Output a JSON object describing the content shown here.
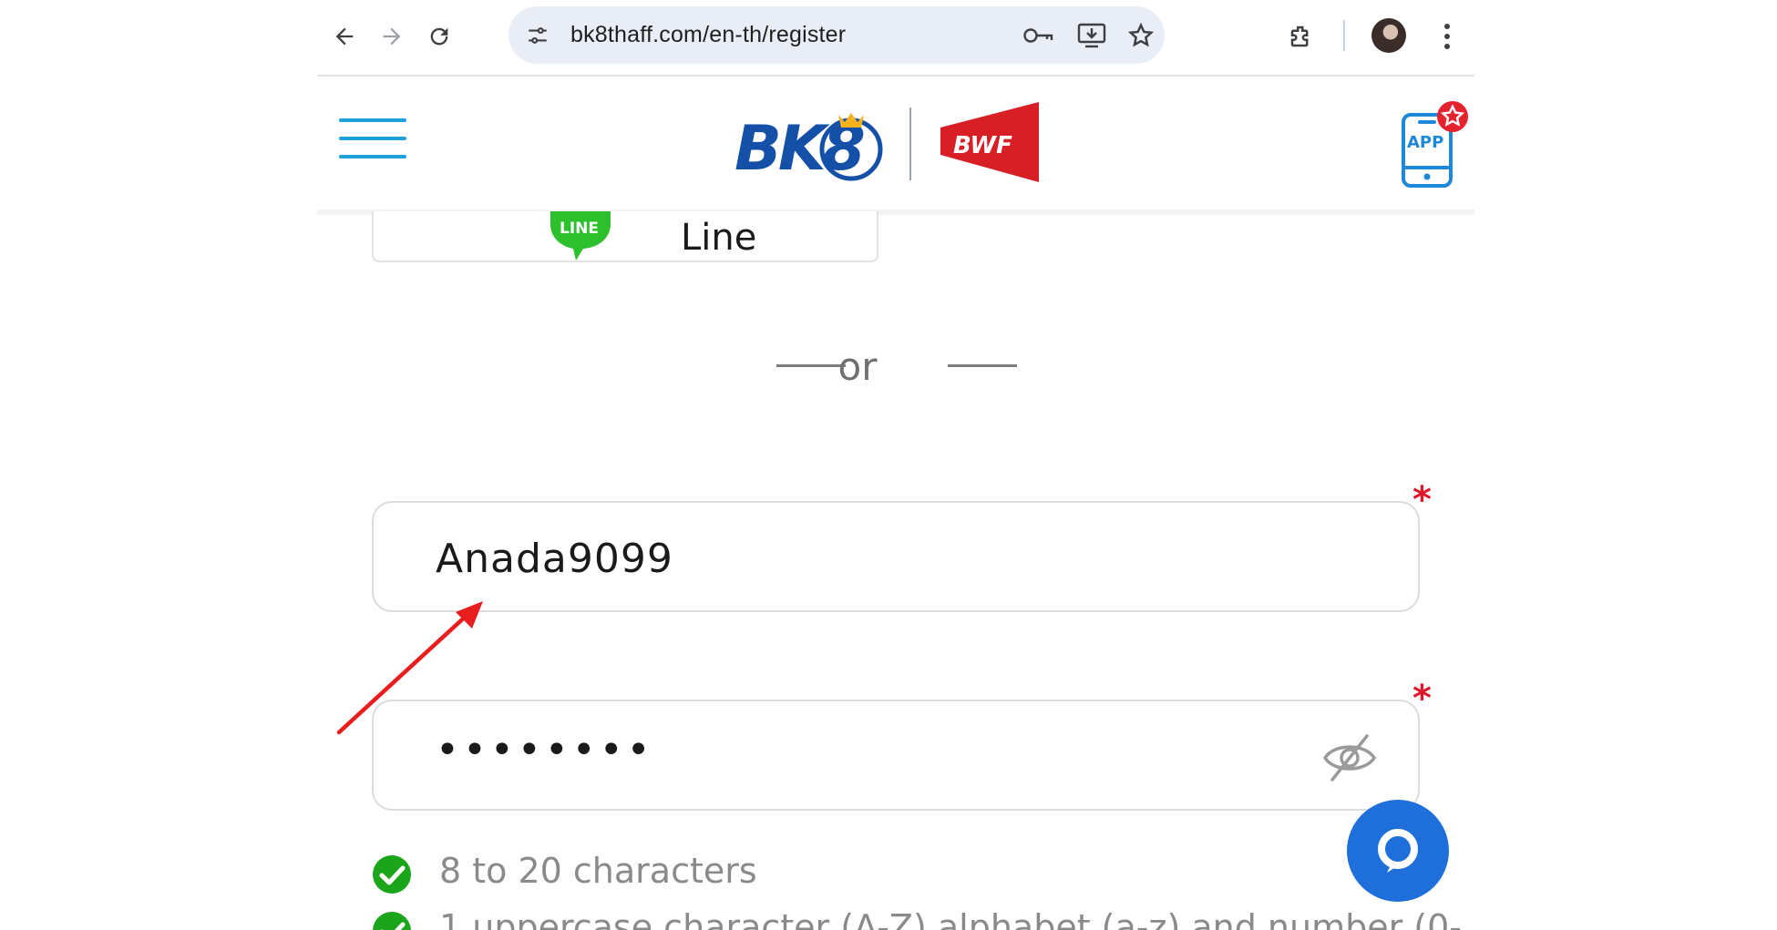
{
  "browser": {
    "url": "bk8thaff.com/en-th/register"
  },
  "header": {
    "logo_bk8": "BK8",
    "logo_bwf": "BWF",
    "app_badge": "APP"
  },
  "social": {
    "line_icon_text": "LINE",
    "line_label": "Line"
  },
  "separator": {
    "or_text": "or"
  },
  "form": {
    "username": {
      "value": "Anada9099",
      "required_mark": "*"
    },
    "password": {
      "masked_value": "••••••••",
      "required_mark": "*"
    },
    "rules": [
      "8 to 20 characters",
      "1 uppercase character (A-Z) alphabet (a-z) and number (0-"
    ]
  },
  "colors": {
    "accent_blue": "#1e6fd9",
    "required_red": "#e0162b",
    "check_green": "#1aa51a",
    "line_green": "#3ac43a"
  },
  "icons": [
    "back-icon",
    "forward-icon",
    "reload-icon",
    "site-settings-icon",
    "password-key-icon",
    "install-app-icon",
    "star-icon",
    "extensions-icon",
    "profile-avatar",
    "more-menu-icon",
    "hamburger-menu-icon",
    "app-download-icon",
    "eye-off-icon",
    "check-circle-icon",
    "chat-icon",
    "red-arrow-annotation"
  ]
}
